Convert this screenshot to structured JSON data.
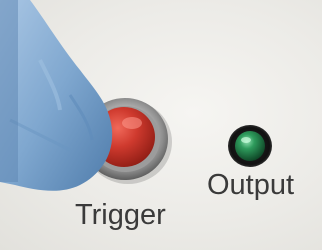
{
  "labels": {
    "trigger": "Trigger",
    "output": "Output"
  },
  "colors": {
    "panel": "#ecebe7",
    "trigger_button": "#c8362b",
    "output_led": "#1f7a45",
    "glove": "#7fa7cf",
    "label_text": "#3a3a3a"
  }
}
